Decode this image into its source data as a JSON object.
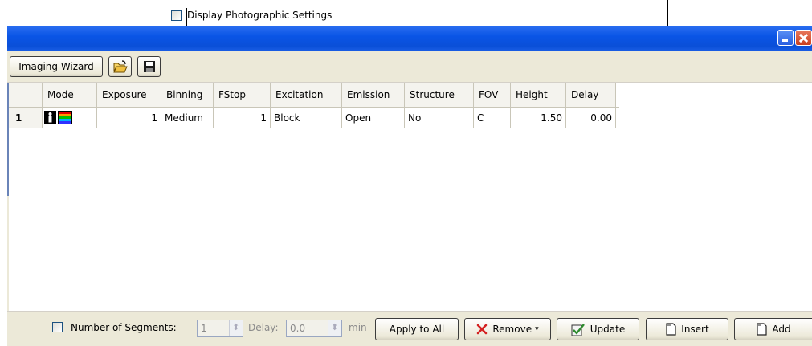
{
  "window": {
    "title": ""
  },
  "toolbar": {
    "wizard_label": "Imaging Wizard",
    "display_settings_label": "Display Photographic Settings"
  },
  "table": {
    "columns": [
      "Mode",
      "Exposure",
      "Binning",
      "FStop",
      "Excitation",
      "Emission",
      "Structure",
      "FOV",
      "Height",
      "Delay"
    ],
    "rows": [
      {
        "index": "1",
        "mode": "",
        "exposure": "1",
        "binning": "Medium",
        "fstop": "1",
        "excitation": "Block",
        "emission": "Open",
        "structure": "No",
        "fov": "C",
        "height": "1.50",
        "delay": "0.00"
      }
    ]
  },
  "bottom": {
    "segments_label": "Number of Segments:",
    "segments_value": "1",
    "delay_label": "Delay:",
    "delay_value": "0.0",
    "unit": "min",
    "apply_all": "Apply to All",
    "remove": "Remove",
    "update": "Update",
    "insert": "Insert",
    "add": "Add"
  },
  "colors": {
    "titlebar": "#0a55e6",
    "chrome": "#ece9d8",
    "remove_icon": "#d42020",
    "update_icon": "#2e8b2e"
  }
}
